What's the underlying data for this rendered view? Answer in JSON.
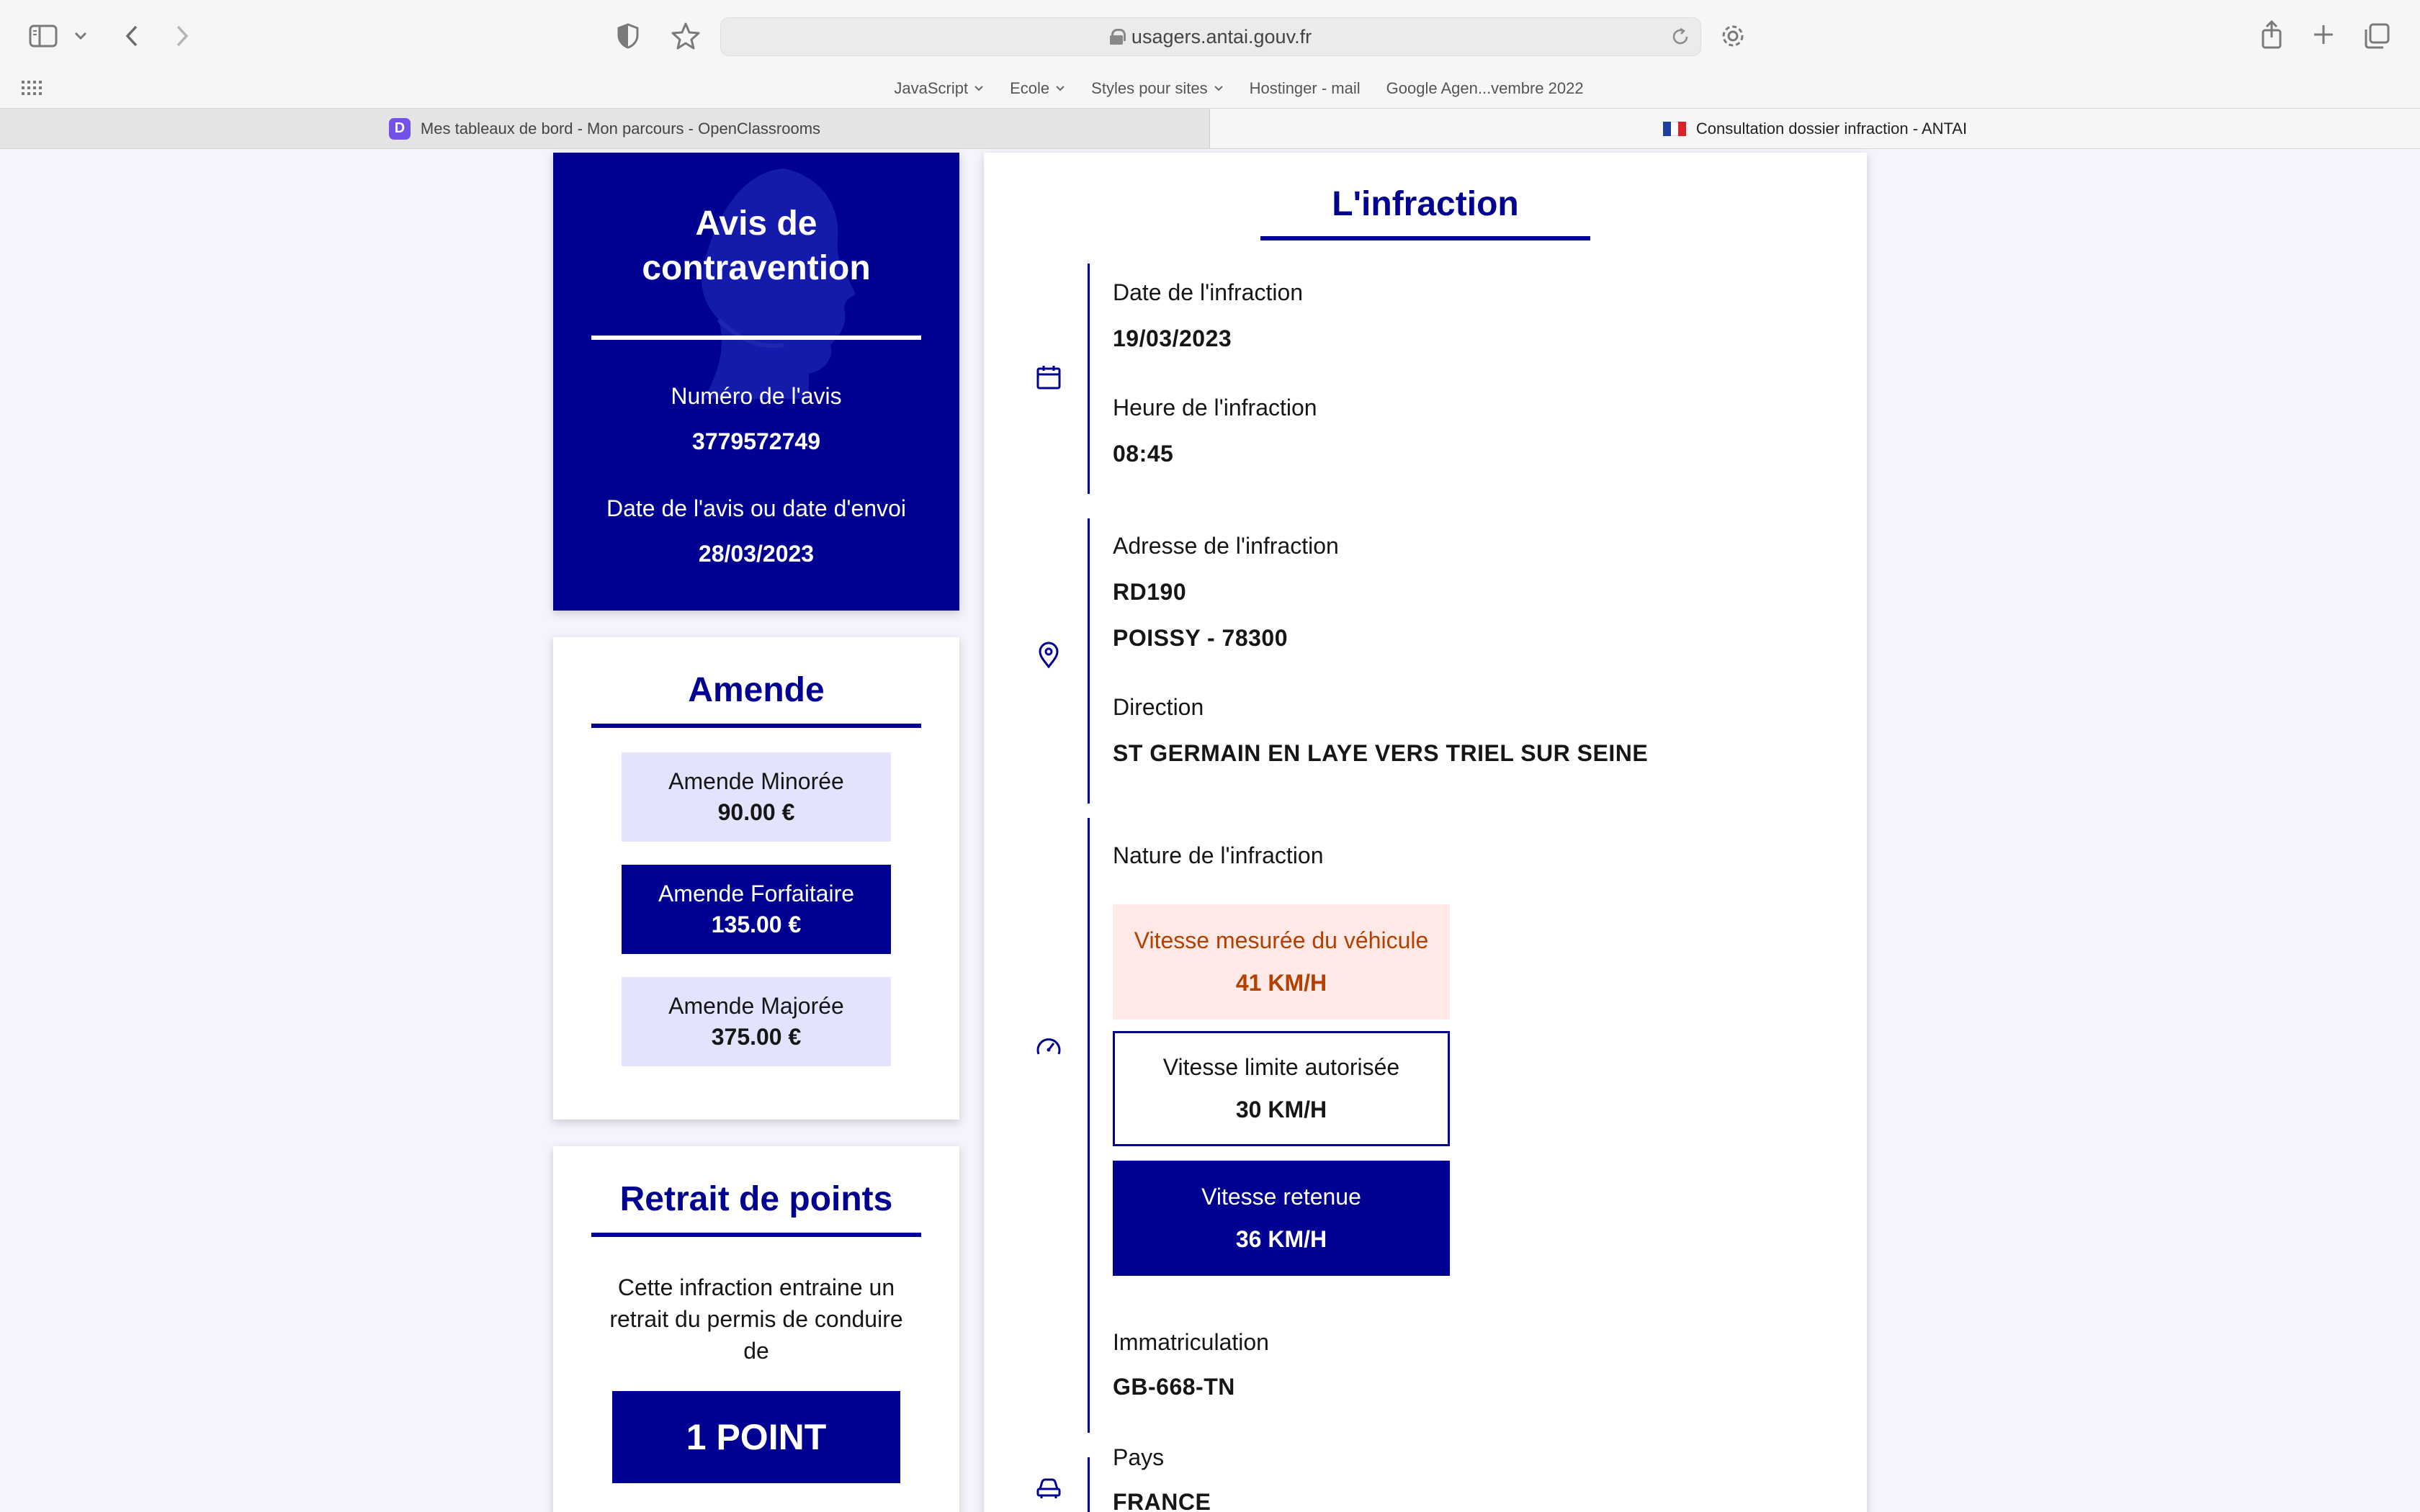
{
  "browser": {
    "url": "usagers.antai.gouv.fr",
    "bookmarks": [
      {
        "label": "JavaScript",
        "has_menu": true
      },
      {
        "label": "Ecole",
        "has_menu": true
      },
      {
        "label": "Styles pour sites",
        "has_menu": true
      },
      {
        "label": "Hostinger - mail",
        "has_menu": false
      },
      {
        "label": "Google Agen...vembre 2022",
        "has_menu": false
      }
    ],
    "tabs": [
      {
        "label": "Mes tableaux de bord - Mon parcours - OpenClassrooms",
        "favicon": "D",
        "active": false
      },
      {
        "label": "Consultation dossier infraction - ANTAI",
        "active": true
      }
    ]
  },
  "avis": {
    "title_line1": "Avis de",
    "title_line2": "contravention",
    "numero_label": "Numéro de l'avis",
    "numero_value": "3779572749",
    "date_label": "Date de l'avis ou date d'envoi",
    "date_value": "28/03/2023"
  },
  "amende": {
    "title": "Amende",
    "items": [
      {
        "label": "Amende Minorée",
        "amount": "90.00 €"
      },
      {
        "label": "Amende Forfaitaire",
        "amount": "135.00 €"
      },
      {
        "label": "Amende Majorée",
        "amount": "375.00 €"
      }
    ]
  },
  "points": {
    "title": "Retrait de points",
    "text": "Cette infraction entraine un retrait du permis de conduire de",
    "value": "1 POINT"
  },
  "infraction": {
    "title": "L'infraction",
    "date_label": "Date de l'infraction",
    "date_value": "19/03/2023",
    "heure_label": "Heure de l'infraction",
    "heure_value": "08:45",
    "adresse_label": "Adresse de l'infraction",
    "adresse_line1": "RD190",
    "adresse_line2": "POISSY - 78300",
    "direction_label": "Direction",
    "direction_value": "ST GERMAIN EN LAYE VERS TRIEL SUR SEINE",
    "nature_label": "Nature de l'infraction",
    "speed_measured_label": "Vitesse mesurée du véhicule",
    "speed_measured_value": "41 KM/H",
    "speed_limit_label": "Vitesse limite autorisée",
    "speed_limit_value": "30 KM/H",
    "speed_retained_label": "Vitesse retenue",
    "speed_retained_value": "36 KM/H",
    "immat_label": "Immatriculation",
    "immat_value": "GB-668-TN",
    "pays_label": "Pays",
    "pays_value": "FRANCE"
  },
  "colors": {
    "primary": "#000091",
    "light_blue": "#e3e3fd",
    "warning_bg": "#fee9e6",
    "warning_text": "#b34000",
    "page_bg": "#f4f5fc"
  }
}
